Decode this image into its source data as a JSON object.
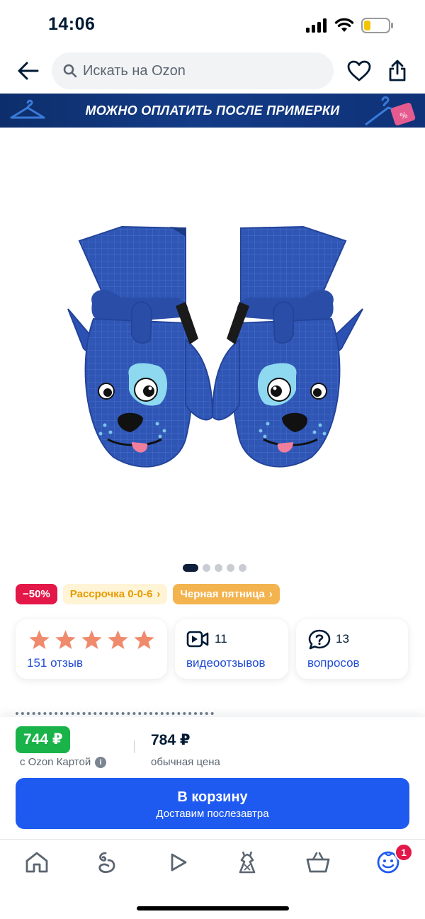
{
  "status_bar": {
    "time": "14:06"
  },
  "header": {
    "search_placeholder": "Искать на Ozon"
  },
  "banner": {
    "text": "МОЖНО ОПЛАТИТЬ ПОСЛЕ ПРИМЕРКИ"
  },
  "gallery": {
    "image_count": 5,
    "active_index": 0
  },
  "badges": {
    "discount": "−50%",
    "installment": "Рассрочка 0-0-6",
    "black_friday": "Черная пятница"
  },
  "reviews_card": {
    "rating_stars": 5,
    "label": "151 отзыв"
  },
  "video_card": {
    "count": "11",
    "label": "видеоотзывов"
  },
  "questions_card": {
    "count": "13",
    "label": "вопросов"
  },
  "price_panel": {
    "ozon_price": "744 ₽",
    "ozon_caption": "с Ozon Картой",
    "regular_price": "784 ₽",
    "regular_caption": "обычная цена",
    "cart_button": "В корзину",
    "cart_subtitle": "Доставим послезавтра"
  },
  "tab_bar": {
    "cart_badge": "1"
  },
  "colors": {
    "brand_blue": "#1f5af0",
    "ozon_green": "#19b349",
    "discount_red": "#e31748",
    "star_color": "#f08a6c",
    "link_blue": "#1f4bd3"
  }
}
